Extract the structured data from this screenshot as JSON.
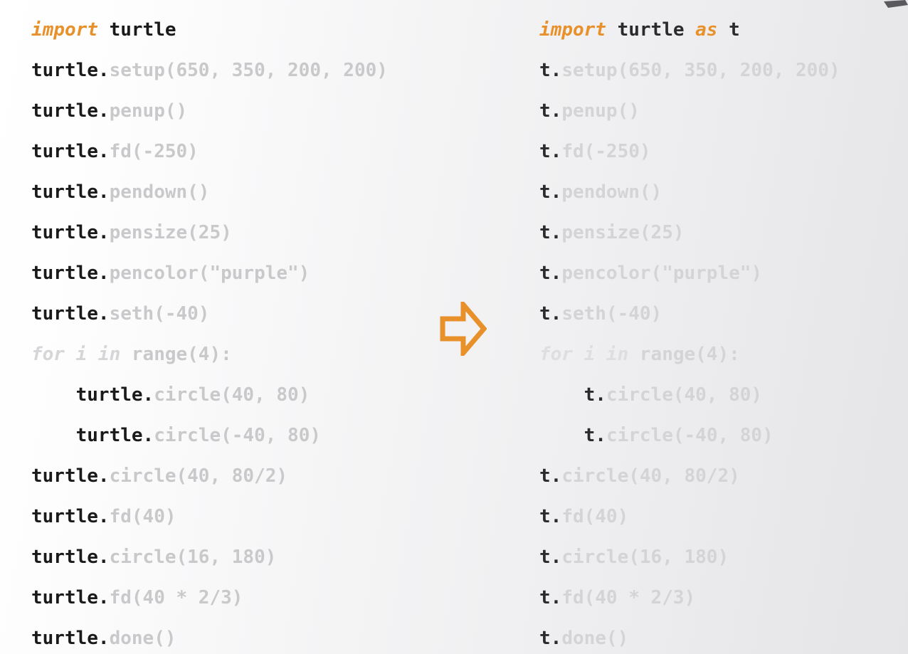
{
  "background": {
    "gradient_from": "#ffffff",
    "gradient_to": "#e5e5e7"
  },
  "palette": {
    "keyword_orange": "#e8902a",
    "object_dark": "#1a1a1a",
    "call_gray": "#c9c9cb",
    "loop_gray": "#d6d6d8",
    "arrow_orange": "#e8902a",
    "corner_mark_gray": "#5a5a5e"
  },
  "arrow": {
    "icon": "arrow-right-outline-icon",
    "color": "#e8902a",
    "direction": "right"
  },
  "corner_mark": {
    "icon": "cursor-corner-icon",
    "color": "#5a5a5e"
  },
  "left_column": {
    "title": "import turtle",
    "lines": [
      {
        "indent": "",
        "kw": "import",
        "obj": " turtle",
        "call": "",
        "kw2": "",
        "obj2": ""
      },
      {
        "indent": "",
        "kw": "",
        "obj": "turtle.",
        "call": "setup(650, 350, 200, 200)"
      },
      {
        "indent": "",
        "kw": "",
        "obj": "turtle.",
        "call": "penup()"
      },
      {
        "indent": "",
        "kw": "",
        "obj": "turtle.",
        "call": "fd(-250)"
      },
      {
        "indent": "",
        "kw": "",
        "obj": "turtle.",
        "call": "pendown()"
      },
      {
        "indent": "",
        "kw": "",
        "obj": "turtle.",
        "call": "pensize(25)"
      },
      {
        "indent": "",
        "kw": "",
        "obj": "turtle.",
        "call": "pencolor(\"purple\")"
      },
      {
        "indent": "",
        "kw": "",
        "obj": "turtle.",
        "call": "seth(-40)"
      },
      {
        "indent": "",
        "loopkw": "for i in",
        "loop": " range(4):"
      },
      {
        "indent": "    ",
        "kw": "",
        "obj": "turtle.",
        "call": "circle(40, 80)"
      },
      {
        "indent": "    ",
        "kw": "",
        "obj": "turtle.",
        "call": "circle(-40, 80)"
      },
      {
        "indent": "",
        "kw": "",
        "obj": "turtle.",
        "call": "circle(40, 80/2)"
      },
      {
        "indent": "",
        "kw": "",
        "obj": "turtle.",
        "call": "fd(40)"
      },
      {
        "indent": "",
        "kw": "",
        "obj": "turtle.",
        "call": "circle(16, 180)"
      },
      {
        "indent": "",
        "kw": "",
        "obj": "turtle.",
        "call": "fd(40 * 2/3)"
      },
      {
        "indent": "",
        "kw": "",
        "obj": "turtle.",
        "call": "done()"
      }
    ]
  },
  "right_column": {
    "title": "import turtle as t",
    "lines": [
      {
        "indent": "",
        "kw": "import",
        "obj": " turtle",
        "kw2": " as",
        "obj2": " t"
      },
      {
        "indent": "",
        "kw": "",
        "obj": "t.",
        "call": "setup(650, 350, 200, 200)"
      },
      {
        "indent": "",
        "kw": "",
        "obj": "t.",
        "call": "penup()"
      },
      {
        "indent": "",
        "kw": "",
        "obj": "t.",
        "call": "fd(-250)"
      },
      {
        "indent": "",
        "kw": "",
        "obj": "t.",
        "call": "pendown()"
      },
      {
        "indent": "",
        "kw": "",
        "obj": "t.",
        "call": "pensize(25)"
      },
      {
        "indent": "",
        "kw": "",
        "obj": "t.",
        "call": "pencolor(\"purple\")"
      },
      {
        "indent": "",
        "kw": "",
        "obj": "t.",
        "call": "seth(-40)"
      },
      {
        "indent": "",
        "loopkw": "for i in",
        "loop": " range(4):"
      },
      {
        "indent": "    ",
        "kw": "",
        "obj": "t.",
        "call": "circle(40, 80)"
      },
      {
        "indent": "    ",
        "kw": "",
        "obj": "t.",
        "call": "circle(-40, 80)"
      },
      {
        "indent": "",
        "kw": "",
        "obj": "t.",
        "call": "circle(40, 80/2)"
      },
      {
        "indent": "",
        "kw": "",
        "obj": "t.",
        "call": "fd(40)"
      },
      {
        "indent": "",
        "kw": "",
        "obj": "t.",
        "call": "circle(16, 180)"
      },
      {
        "indent": "",
        "kw": "",
        "obj": "t.",
        "call": "fd(40 * 2/3)"
      },
      {
        "indent": "",
        "kw": "",
        "obj": "t.",
        "call": "done()"
      }
    ]
  }
}
